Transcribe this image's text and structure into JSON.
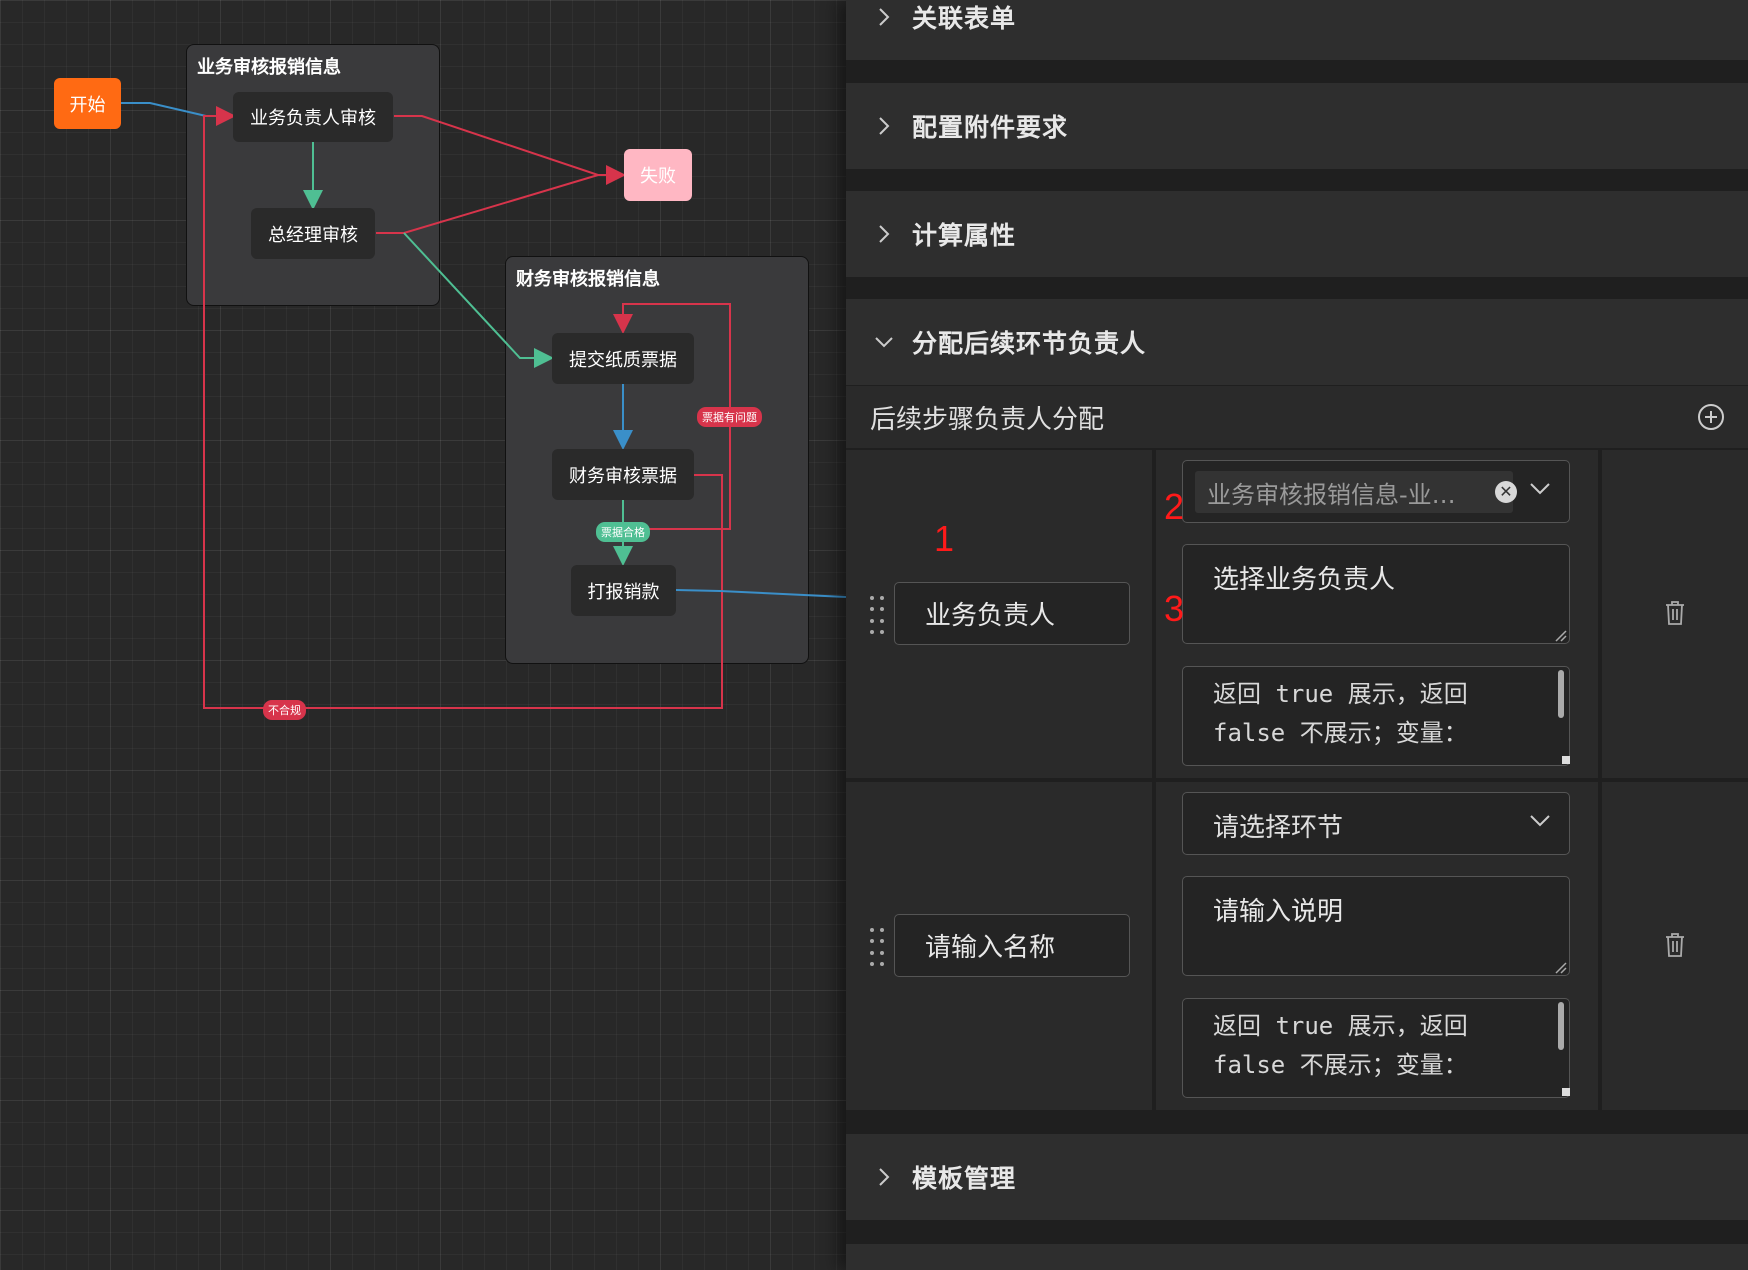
{
  "canvas": {
    "start_label": "开始",
    "fail_label": "失败",
    "group1": {
      "title": "业务审核报销信息",
      "nodes": [
        "业务负责人审核",
        "总经理审核"
      ]
    },
    "group2": {
      "title": "财务审核报销信息",
      "nodes": [
        "提交纸质票据",
        "财务审核票据",
        "打报销款"
      ]
    },
    "edge_labels": {
      "ticket_issue": "票据有问题",
      "ticket_ok": "票据合格",
      "non_compliant": "不合规"
    },
    "colors": {
      "red": "#d7344b",
      "green": "#4fbf93",
      "blue": "#3a8fc9",
      "start": "#ff6a13",
      "fail": "#ffb7c3"
    }
  },
  "panel": {
    "sections": [
      {
        "title": "关联表单",
        "expanded": false,
        "icon": "chevron-right-icon"
      },
      {
        "title": "配置附件要求",
        "expanded": false,
        "icon": "chevron-right-icon"
      },
      {
        "title": "计算属性",
        "expanded": false,
        "icon": "chevron-right-icon"
      },
      {
        "title": "分配后续环节负责人",
        "expanded": true,
        "icon": "chevron-down-icon"
      },
      {
        "title": "模板管理",
        "expanded": false,
        "icon": "chevron-right-icon"
      }
    ],
    "assign": {
      "subheader": "后续步骤负责人分配",
      "rows": [
        {
          "name_value": "业务负责人",
          "step_select_value": "业务审核报销信息-业…",
          "description_value": "选择业务负责人",
          "condition_text": "返回 true 展示，返回\nfalse 不展示；变量："
        },
        {
          "name_placeholder": "请输入名称",
          "step_select_placeholder": "请选择环节",
          "description_placeholder": "请输入说明",
          "condition_text": "返回 true 展示，返回\nfalse 不展示；变量："
        }
      ]
    },
    "markers": [
      "1",
      "2",
      "3"
    ]
  }
}
